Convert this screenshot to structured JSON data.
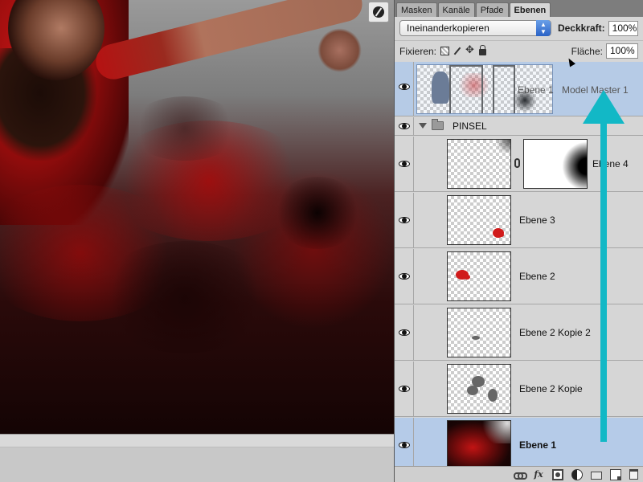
{
  "panel": {
    "tabs": [
      {
        "label": "Masken",
        "active": false
      },
      {
        "label": "Kanäle",
        "active": false
      },
      {
        "label": "Pfade",
        "active": false
      },
      {
        "label": "Ebenen",
        "active": true
      }
    ],
    "blend_mode": "Ineinanderkopieren",
    "opacity_label": "Deckkraft:",
    "opacity_value": "100%",
    "lock_label": "Fixieren:",
    "fill_label": "Fläche:",
    "fill_value": "100%"
  },
  "layers": {
    "master": {
      "name": "Ebene 1",
      "extra_label": "Model Master 1"
    },
    "group": {
      "name": "PINSEL",
      "expanded": true
    },
    "ebene4": {
      "name": "Ebene 4"
    },
    "ebene3": {
      "name": "Ebene 3"
    },
    "ebene2": {
      "name": "Ebene 2"
    },
    "ebene2_kopie2": {
      "name": "Ebene 2 Kopie 2"
    },
    "ebene2_kopie": {
      "name": "Ebene 2 Kopie"
    },
    "ebene1": {
      "name": "Ebene 1",
      "selected": true
    }
  },
  "toolbar_icons": [
    "link-layers-icon",
    "fx-icon",
    "mask-icon",
    "adjustment-icon",
    "group-folder-icon",
    "new-layer-icon",
    "trash-icon"
  ],
  "colors": {
    "selection": "#b5cbe8",
    "arrow": "#12b8c6",
    "panel_bg": "#d6d6d6"
  }
}
